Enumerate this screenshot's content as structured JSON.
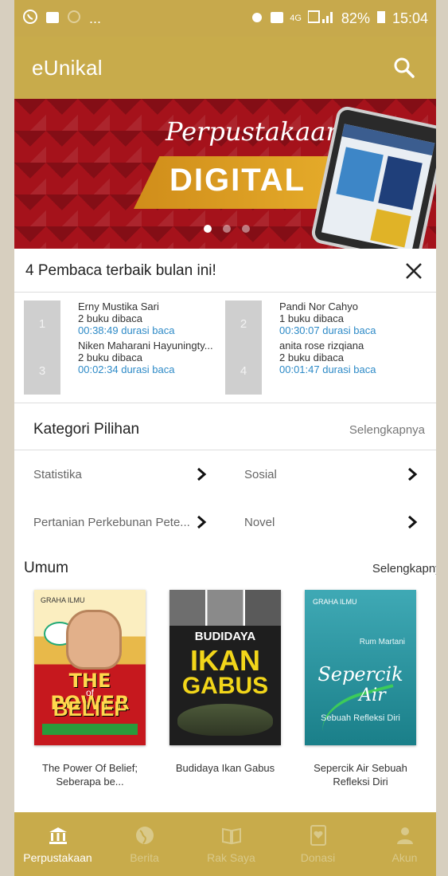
{
  "status_bar": {
    "left_dots": "...",
    "network": "4G",
    "battery": "82%",
    "time": "15:04"
  },
  "app_bar": {
    "title": "eUnikal",
    "search_icon": "search-icon"
  },
  "banner": {
    "script_text": "Perpustakaan",
    "headline": "DIGITAL",
    "active_slide": 1,
    "slide_count": 3
  },
  "top_readers": {
    "title": "4 Pembaca terbaik bulan ini!",
    "close_icon": "close-icon",
    "readers": [
      {
        "rank": "1",
        "name": "Erny Mustika Sari",
        "count": "2 buku dibaca",
        "duration": "00:38:49 durasi baca"
      },
      {
        "rank": "2",
        "name": "Pandi Nor Cahyo",
        "count": "1 buku dibaca",
        "duration": "00:30:07 durasi baca"
      },
      {
        "rank": "3",
        "name": "Niken Maharani Hayuningty...",
        "count": "2 buku dibaca",
        "duration": "00:02:34 durasi baca"
      },
      {
        "rank": "4",
        "name": "anita rose rizqiana",
        "count": "2 buku dibaca",
        "duration": "00:01:47 durasi baca"
      }
    ]
  },
  "kategori": {
    "title": "Kategori Pilihan",
    "more": "Selengkapnya",
    "items": [
      "Statistika",
      "Sosial",
      "Pertanian Perkebunan Pete...",
      "Novel"
    ]
  },
  "umum": {
    "title": "Umum",
    "more": "Selengkapnya",
    "books": [
      {
        "title": "The Power Of Belief; Seberapa be...",
        "cover_l1": "THE POWER",
        "cover_l2": "of",
        "cover_l3": "BELIEF",
        "brand": "GRAHA ILMU"
      },
      {
        "title": "Budidaya Ikan Gabus",
        "cover_l1": "BUDIDAYA",
        "cover_l2": "IKAN",
        "cover_l3": "GABUS"
      },
      {
        "title": "Sepercik Air Sebuah Refleksi Diri",
        "cover_l1": "Sepercik",
        "cover_l2": "Air",
        "cover_l3": "Sebuah Refleksi Diri",
        "author": "Rum Martani",
        "brand": "GRAHA ILMU"
      }
    ]
  },
  "bottom_nav": {
    "items": [
      {
        "label": "Perpustakaan",
        "icon": "library-icon"
      },
      {
        "label": "Berita",
        "icon": "globe-icon"
      },
      {
        "label": "Rak Saya",
        "icon": "book-icon"
      },
      {
        "label": "Donasi",
        "icon": "donation-icon"
      },
      {
        "label": "Akun",
        "icon": "person-icon"
      }
    ],
    "active": "Perpustakaan"
  },
  "colors": {
    "accent": "#c8ab4b",
    "link": "#2d8ac7",
    "banner_red": "#a5121b"
  }
}
